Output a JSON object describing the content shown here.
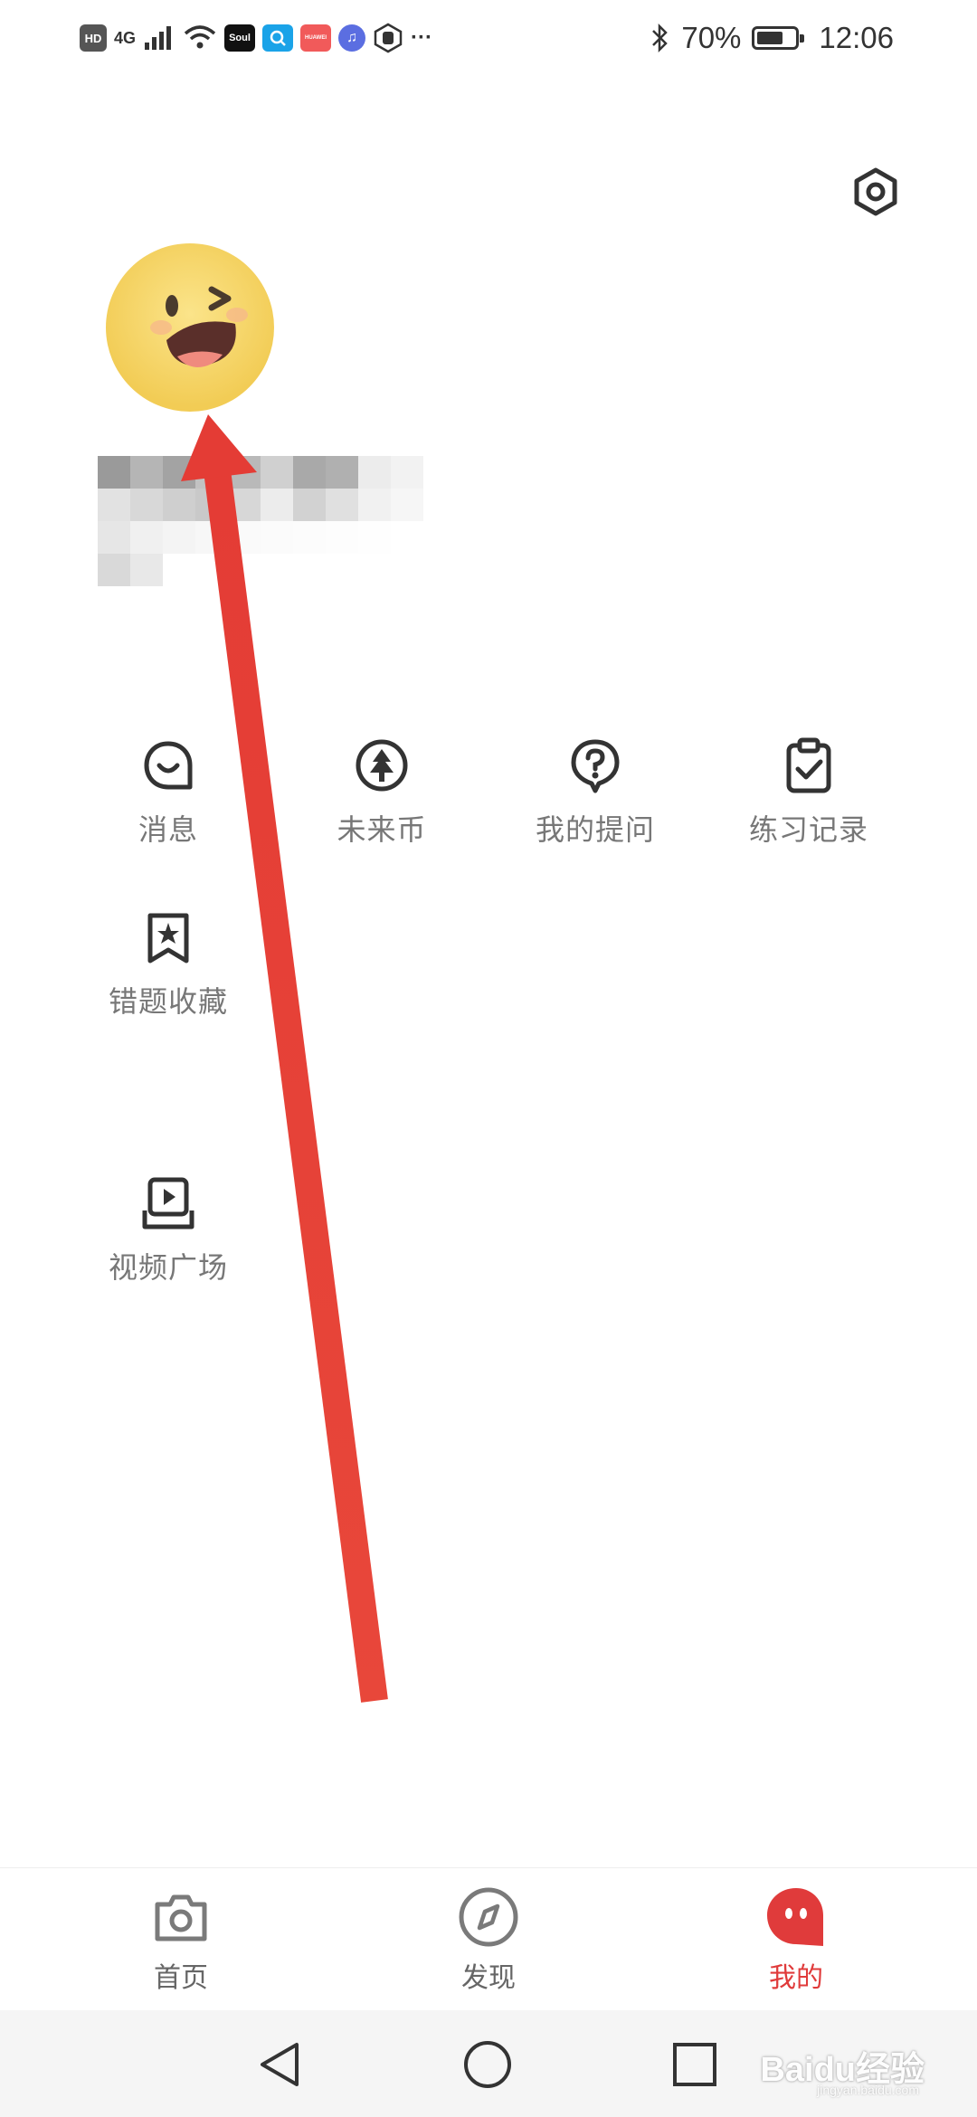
{
  "status_bar": {
    "hd_badge": "HD",
    "network": "4G",
    "app_badges": [
      {
        "name": "soul-app-icon",
        "label": "Soul",
        "color": "#111111"
      },
      {
        "name": "search-app-icon",
        "label": "",
        "color": "#1aa3e8"
      },
      {
        "name": "huawei-app-icon",
        "label": "HUAWEI",
        "color": "#f15a5a"
      },
      {
        "name": "music-app-icon",
        "label": "",
        "color": "#5b6ee1"
      }
    ],
    "more": "···",
    "battery_percent_text": "70%",
    "battery_level": 0.7,
    "time": "12:06"
  },
  "profile": {
    "avatar_icon": "wink-smile-face"
  },
  "menu": {
    "row1": [
      {
        "label": "消息",
        "icon": "message-icon"
      },
      {
        "label": "未来币",
        "icon": "coin-tree-icon"
      },
      {
        "label": "我的提问",
        "icon": "question-bubble-icon"
      },
      {
        "label": "练习记录",
        "icon": "clipboard-check-icon"
      }
    ],
    "row2": [
      {
        "label": "错题收藏",
        "icon": "bookmark-star-icon"
      }
    ],
    "row3": [
      {
        "label": "视频广场",
        "icon": "video-play-icon"
      }
    ]
  },
  "bottom_nav": [
    {
      "label": "首页",
      "icon": "camera-icon",
      "active": false
    },
    {
      "label": "发现",
      "icon": "compass-icon",
      "active": false
    },
    {
      "label": "我的",
      "icon": "chat-face-icon",
      "active": true
    }
  ],
  "colors": {
    "accent": "#e03b3b",
    "arrow": "#e8473a",
    "avatar_yellow": "#f7d66a"
  },
  "watermark": {
    "text": "Baidu经验",
    "sub": "jingyan.baidu.com"
  }
}
